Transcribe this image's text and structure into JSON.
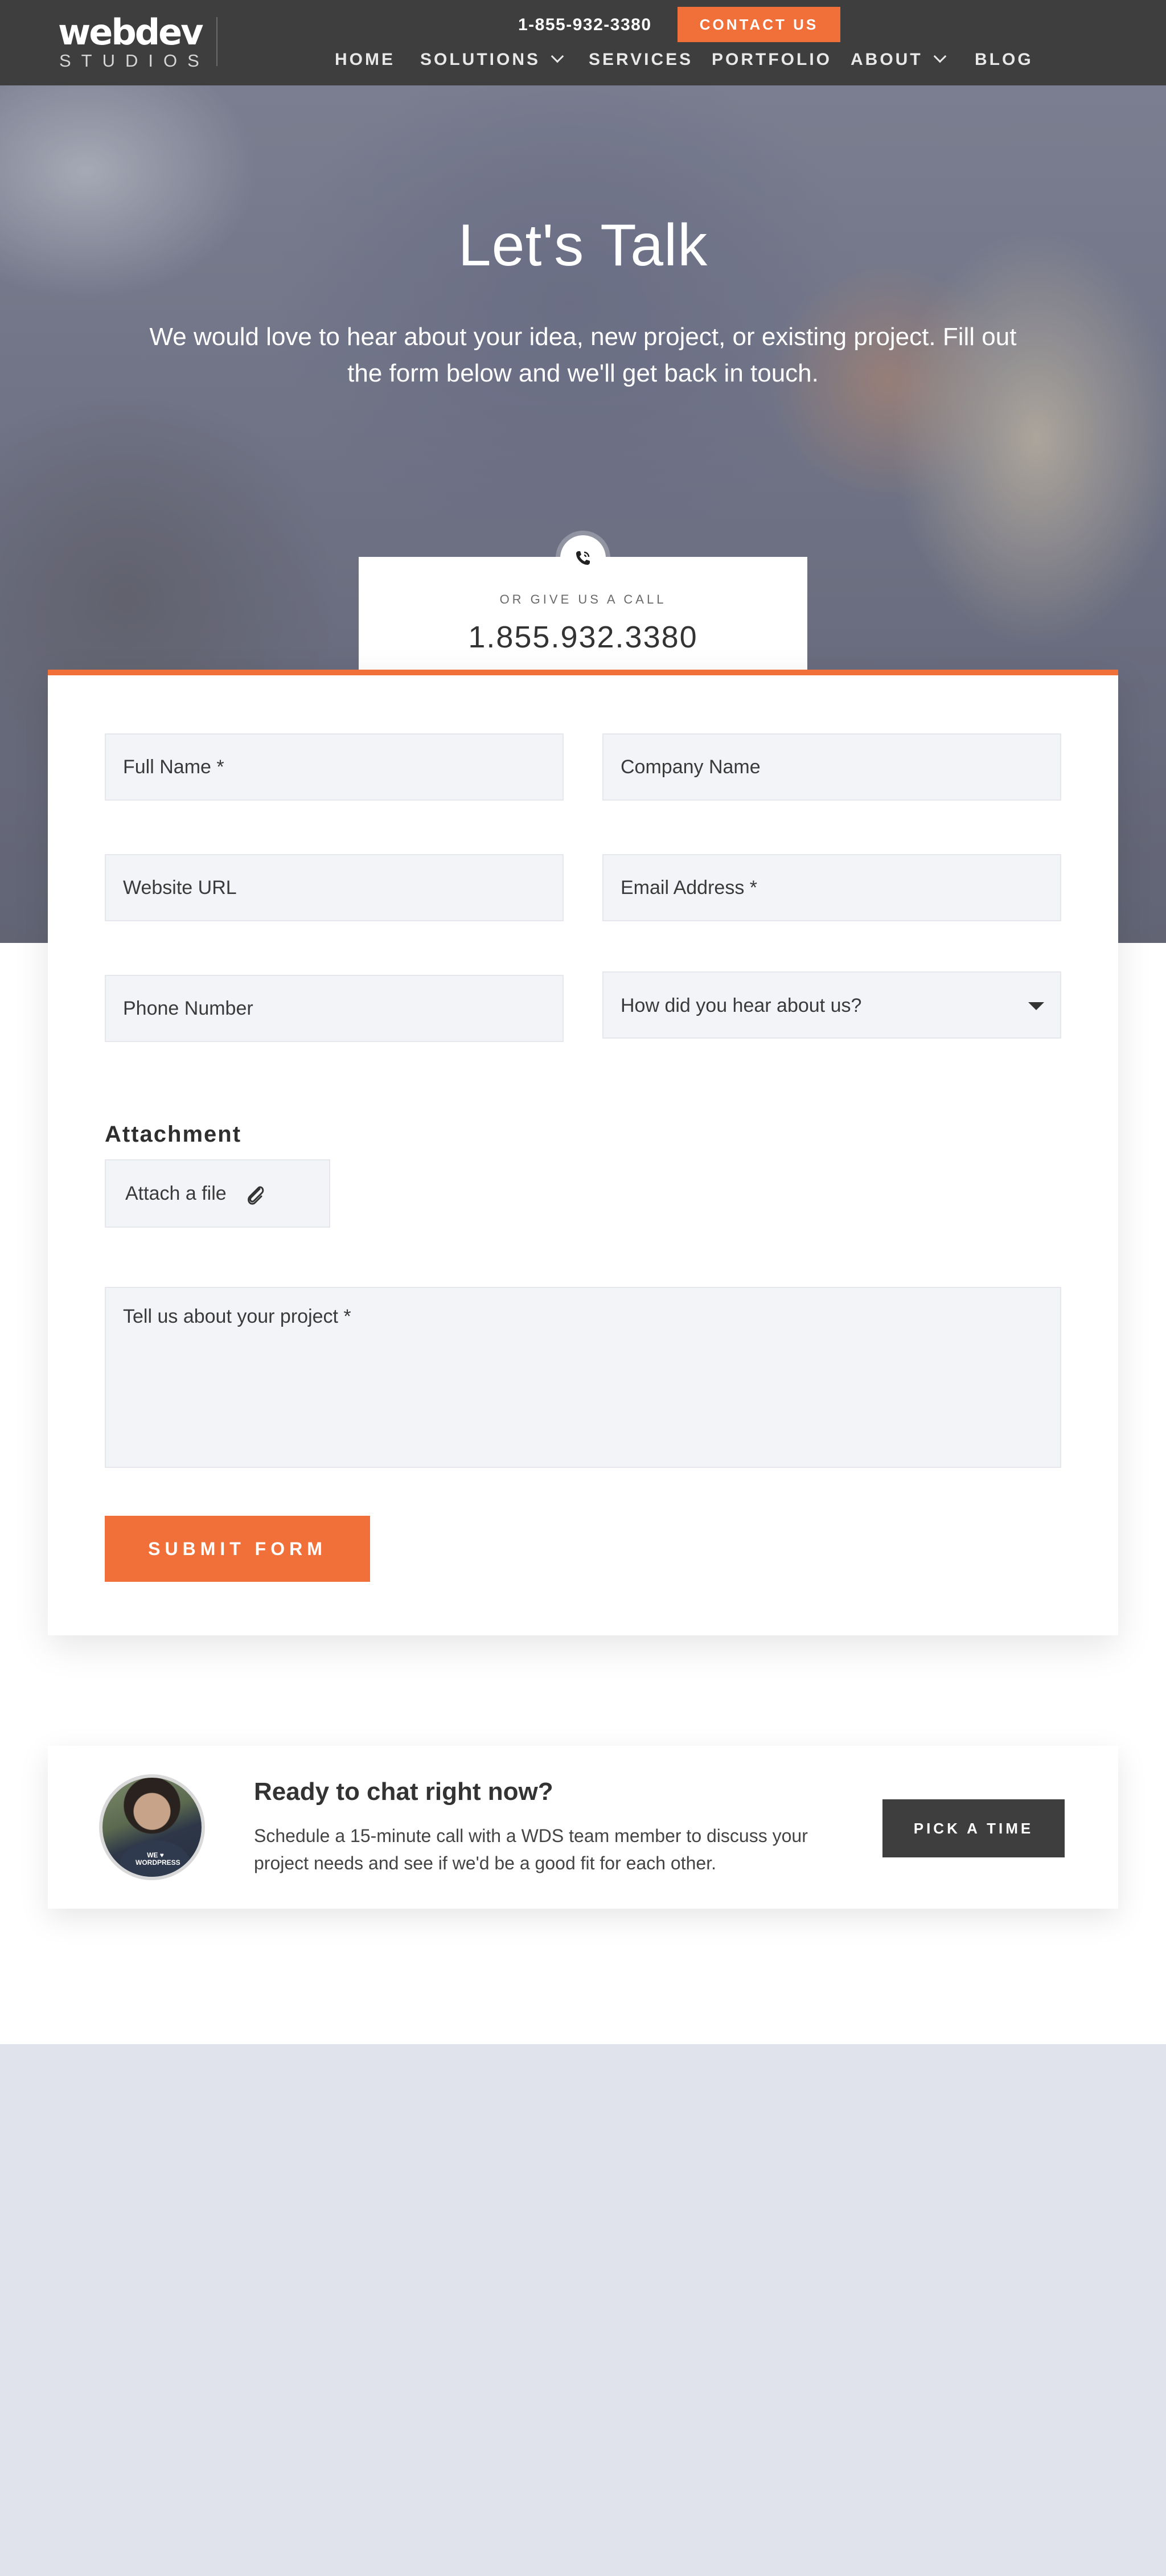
{
  "header": {
    "logo_top": "webdev",
    "logo_bottom": "STUDIOS",
    "phone": "1-855-932-3380",
    "contact_label": "CONTACT US",
    "nav": [
      {
        "label": "HOME"
      },
      {
        "label": "SOLUTIONS"
      },
      {
        "label": "SERVICES"
      },
      {
        "label": "PORTFOLIO"
      },
      {
        "label": "ABOUT"
      },
      {
        "label": "BLOG"
      }
    ]
  },
  "hero": {
    "title": "Let's Talk",
    "subtitle": "We would love to hear about your idea, new project, or existing project. Fill out the form below and we'll get back in touch.",
    "call_label": "OR GIVE US A CALL",
    "call_number": "1.855.932.3380"
  },
  "form": {
    "full_name": "Full Name *",
    "company_name": "Company Name",
    "website_url": "Website URL",
    "email": "Email Address *",
    "phone": "Phone Number",
    "referral": "How did you hear about us?",
    "attachment_title": "Attachment",
    "attach_label": "Attach a file",
    "project": "Tell us about your project *",
    "submit_label": "SUBMIT FORM"
  },
  "chat": {
    "title": "Ready to chat right now?",
    "description": "Schedule a 15-minute call with a WDS team member to discuss your project needs and see if we'd be a good fit for each other.",
    "button_label": "PICK A TIME",
    "avatar_text": "WE ♥ WORDPRESS"
  },
  "colors": {
    "accent": "#f1703a",
    "header_bg": "#3d3e3d",
    "field_bg": "#f3f4f8",
    "footer_bg": "#e1e3ec"
  }
}
